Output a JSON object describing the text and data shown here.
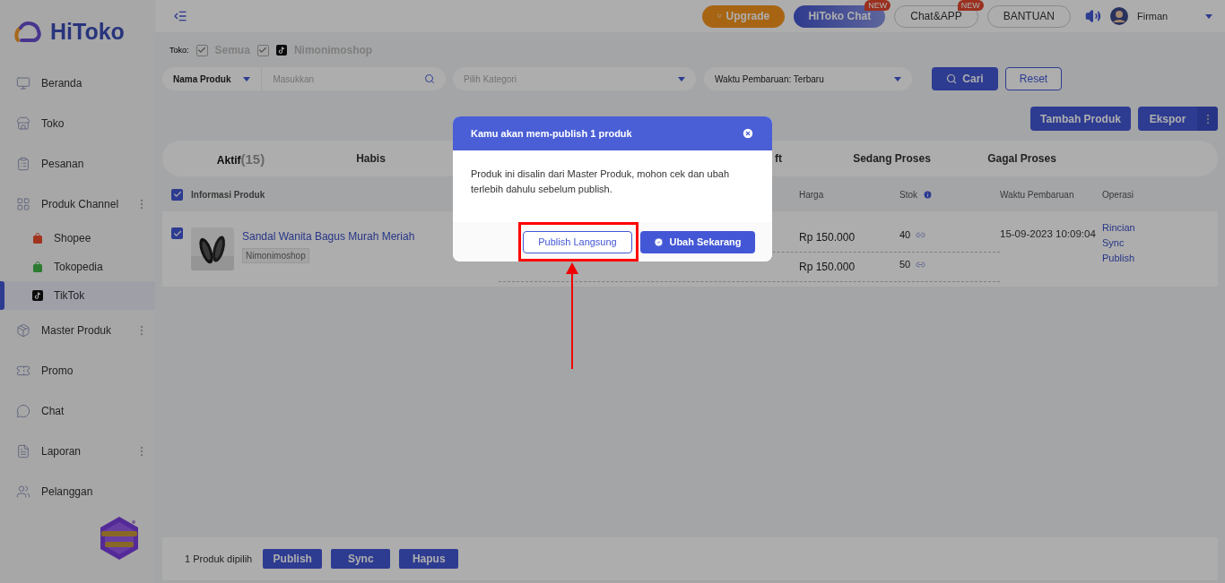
{
  "logo": {
    "text": "HiToko"
  },
  "sidebar": {
    "items": [
      {
        "label": "Beranda",
        "selected": false
      },
      {
        "label": "Toko",
        "selected": false
      },
      {
        "label": "Pesanan",
        "selected": false
      },
      {
        "label": "Produk Channel",
        "selected": false,
        "has_submenu": true,
        "children": [
          {
            "label": "Shopee",
            "selected": false
          },
          {
            "label": "Tokopedia",
            "selected": false
          },
          {
            "label": "TikTok",
            "selected": true
          }
        ]
      },
      {
        "label": "Master Produk",
        "selected": false,
        "has_submenu": true
      },
      {
        "label": "Promo",
        "selected": false
      },
      {
        "label": "Chat",
        "selected": false
      },
      {
        "label": "Laporan",
        "selected": false,
        "has_submenu": true
      },
      {
        "label": "Pelanggan",
        "selected": false
      }
    ]
  },
  "topbar": {
    "buttons": [
      {
        "kind": "upgrade",
        "label": "Upgrade"
      },
      {
        "kind": "chat",
        "label": "HiToko Chat",
        "badge": "NEW"
      },
      {
        "kind": "outline",
        "label": "Chat&APP",
        "badge": "NEW"
      },
      {
        "kind": "outline",
        "label": "BANTUAN"
      }
    ],
    "user": "Firman"
  },
  "store_filter": {
    "label": "Toko:",
    "options": [
      {
        "label": "Semua",
        "checked": true,
        "disabled": true,
        "tiktok": false
      },
      {
        "label": "Nimonimoshop",
        "checked": true,
        "disabled": true,
        "tiktok": true
      }
    ]
  },
  "filters": {
    "field_select": "Nama Produk",
    "search_placeholder": "Masukkan",
    "category_placeholder": "Pilih Kategori",
    "sort_select": "Waktu Pembaruan: Terbaru",
    "search_button": "Cari",
    "reset_button": "Reset"
  },
  "actions": {
    "add": "Tambah Produk",
    "export": "Ekspor"
  },
  "tabs": [
    {
      "label": "Aktif",
      "count": "(15)",
      "selected": true,
      "partial": false
    },
    {
      "label": "Habis",
      "selected": false,
      "partial": false
    },
    {
      "label": "ft",
      "selected": false,
      "partial": true
    },
    {
      "label": "Sedang Proses",
      "selected": false,
      "partial": false
    },
    {
      "label": "Gagal Proses",
      "selected": false,
      "partial": false
    }
  ],
  "table": {
    "select_all_checked": true,
    "columns": {
      "product": "Informasi Produk",
      "price": "Harga",
      "stock": "Stok",
      "updated": "Waktu Pembaruan",
      "operation": "Operasi"
    },
    "rows": [
      {
        "checked": true,
        "title": "Sandal Wanita Bagus Murah Meriah",
        "shop": "Nimonimoshop",
        "image": {
          "kind": "picture"
        },
        "variants": [
          {
            "price": "Rp 150.000",
            "stock": "40"
          },
          {
            "price": "Rp 150.000",
            "stock": "50"
          }
        ],
        "updated": "15-09-2023 10:09:04",
        "operations": [
          "Rincian",
          "Sync",
          "Publish"
        ]
      }
    ]
  },
  "bulk_bar": {
    "count_text": "1 Produk dipilih",
    "buttons": [
      "Publish",
      "Sync",
      "Hapus"
    ]
  },
  "dialog": {
    "title": "Kamu akan mem-publish 1 produk",
    "message": "Produk ini disalin dari Master Produk, mohon cek dan ubah terlebih dahulu sebelum publish.",
    "secondary_button": "Publish Langsung",
    "primary_button": "Ubah Sekarang",
    "secondary_highlighted": true
  }
}
